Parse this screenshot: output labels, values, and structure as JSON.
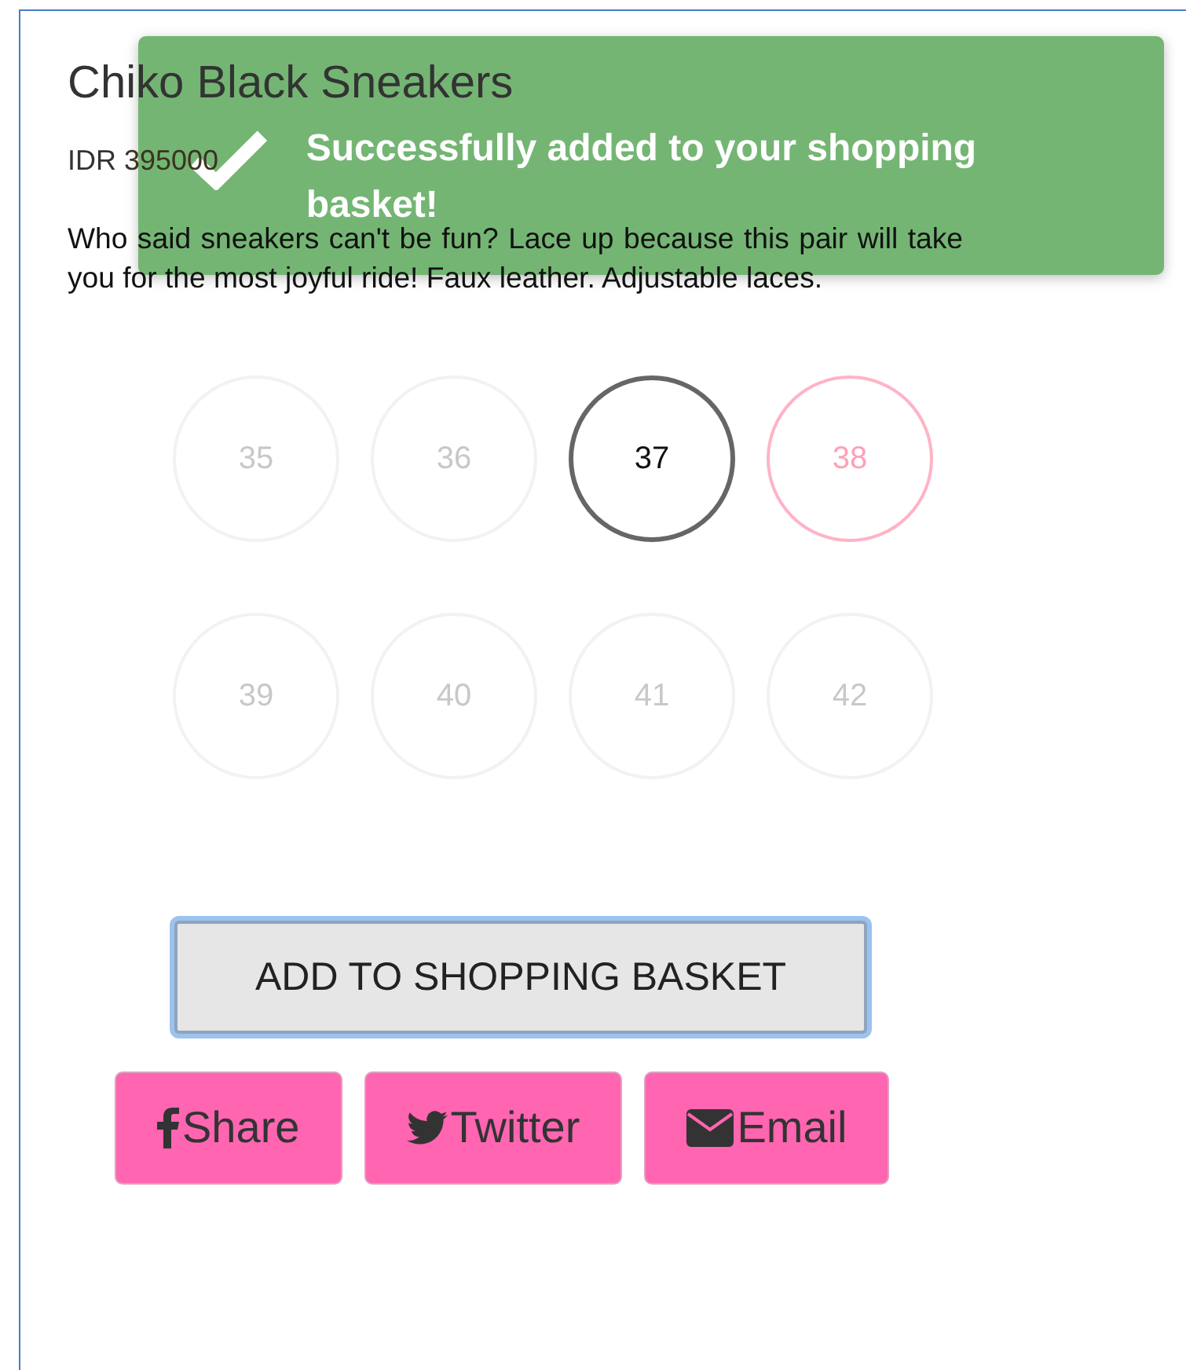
{
  "product": {
    "title": "Chiko Black Sneakers",
    "currency": "IDR",
    "price": "395000",
    "description": "Who said sneakers can't be fun? Lace up because this pair will take you for the most joyful ride! Faux leather. Adjustable laces."
  },
  "sizes": [
    {
      "label": "35",
      "selected": false,
      "hovered": false
    },
    {
      "label": "36",
      "selected": false,
      "hovered": false
    },
    {
      "label": "37",
      "selected": true,
      "hovered": false
    },
    {
      "label": "38",
      "selected": false,
      "hovered": true
    },
    {
      "label": "39",
      "selected": false,
      "hovered": false
    },
    {
      "label": "40",
      "selected": false,
      "hovered": false
    },
    {
      "label": "41",
      "selected": false,
      "hovered": false
    },
    {
      "label": "42",
      "selected": false,
      "hovered": false
    }
  ],
  "add_button": {
    "label": "ADD TO SHOPPING BASKET",
    "focused": true
  },
  "share_buttons": [
    {
      "kind": "facebook",
      "label": "Share"
    },
    {
      "kind": "twitter",
      "label": "Twitter"
    },
    {
      "kind": "email",
      "label": "Email"
    }
  ],
  "toast": {
    "message": "Successfully added to your shopping basket!"
  }
}
